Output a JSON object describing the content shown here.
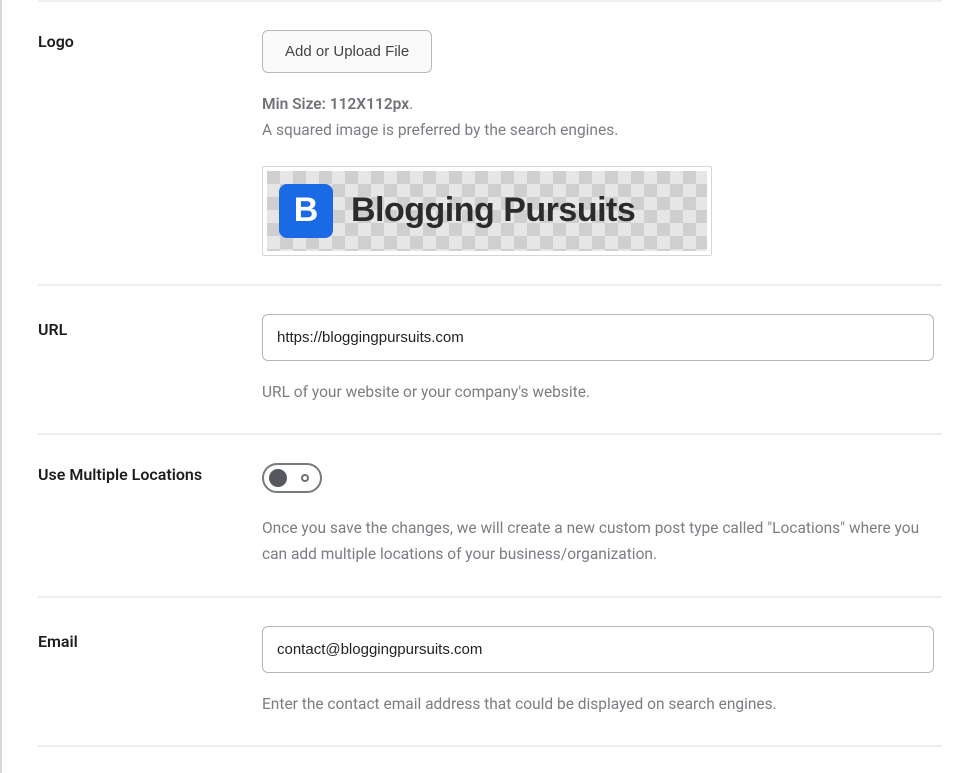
{
  "logo": {
    "label": "Logo",
    "upload_button": "Add or Upload File",
    "min_size_label": "Min Size: 112X112px",
    "hint": "A squared image is preferred by the search engines.",
    "preview_mark": "B",
    "preview_text": "Blogging Pursuits"
  },
  "url": {
    "label": "URL",
    "value": "https://bloggingpursuits.com",
    "hint": "URL of your website or your company's website."
  },
  "multi_locations": {
    "label": "Use Multiple Locations",
    "state": "off",
    "hint": "Once you save the changes, we will create a new custom post type called \"Locations\" where you can add multiple locations of your business/organization."
  },
  "email": {
    "label": "Email",
    "value": "contact@bloggingpursuits.com",
    "hint": "Enter the contact email address that could be displayed on search engines."
  }
}
